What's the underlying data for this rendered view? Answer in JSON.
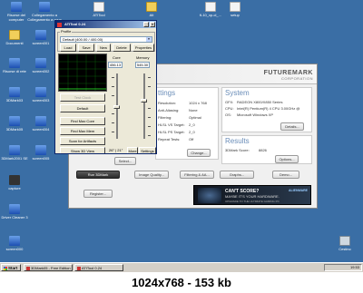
{
  "desktop": {
    "icons": [
      {
        "label": "Risorse del computer",
        "type": "blue"
      },
      {
        "label": "Collegamento a Collegamento a cpuz",
        "type": "blue"
      },
      {
        "label": "ATITool",
        "type": "doc"
      },
      {
        "label": "Alt",
        "type": "folder"
      },
      {
        "label": "fi-10_xp-cl_...",
        "type": "doc"
      },
      {
        "label": "setup",
        "type": "doc"
      },
      {
        "label": "Documenti",
        "type": "folder"
      },
      {
        "label": "screen001",
        "type": "blue"
      },
      {
        "label": "Risorse di rete",
        "type": "blue"
      },
      {
        "label": "screen002",
        "type": "blue"
      },
      {
        "label": "3DMark03",
        "type": "blue"
      },
      {
        "label": "screen003",
        "type": "blue"
      },
      {
        "label": "3DMark05",
        "type": "blue"
      },
      {
        "label": "screen004",
        "type": "blue"
      },
      {
        "label": "3DMark2001 SE",
        "type": "blue"
      },
      {
        "label": "screen005",
        "type": "blue"
      },
      {
        "label": "capture",
        "type": "dark"
      },
      {
        "label": "Driver Cleaner 3",
        "type": "blue"
      },
      {
        "label": "screen000",
        "type": "blue"
      },
      {
        "label": "Cestino",
        "type": "bin"
      }
    ]
  },
  "mark": {
    "brand": "FUTUREMARK",
    "brand_sub": "CORPORATION",
    "settings_title": "ttings",
    "settings_rows": [
      {
        "label": "Resolution:",
        "value": "1024 x 768"
      },
      {
        "label": "Anti-Aliasing:",
        "value": "None"
      },
      {
        "label": "Filtering:",
        "value": "Optimal"
      },
      {
        "label": "HLSL VS Target:",
        "value": "2_0"
      },
      {
        "label": "HLSL PS Target:",
        "value": "2_0"
      },
      {
        "label": "Repeat Tests:",
        "value": "Off"
      }
    ],
    "change_label": "Change...",
    "select_label": "Select...",
    "system_title": "System",
    "system_rows": [
      {
        "label": "GFX:",
        "value": "RADEON X800/X850 Series"
      },
      {
        "label": "CPU:",
        "value": "Intel(R) Pentium(R) 4 CPU 3.00GHz @"
      },
      {
        "label": "OS:",
        "value": "Microsoft Windows XP"
      }
    ],
    "details_label": "Details...",
    "results_title": "Results",
    "results_rows": [
      {
        "label": "3DMark Score:",
        "value": "8826"
      }
    ],
    "options_label": "Options...",
    "run_label": "Run 3DMark",
    "image_quality_label": "Image Quality...",
    "filtering_label": "Filtering & AA...",
    "graphs_label": "Graphs...",
    "demo_label": "Demo...",
    "register_label": "Register...",
    "ad": {
      "line1": "CAN'T SCORE?",
      "line2": "MAYBE IT'S YOUR HARDWARE.",
      "line3": "UPGRADE TO THE ULTIMATE GAMING PC",
      "brand": "ALIENWARE"
    }
  },
  "ati": {
    "title": "ATITool 0.24",
    "profile_label": "Profile",
    "profile_value": "Default (400.00 / 400.00)",
    "buttons": {
      "load": "Load",
      "save": "Save",
      "new": "New",
      "delete": "Delete",
      "properties": "Properties"
    },
    "temp_label": "Test Clock",
    "default_label": "Default",
    "find_core": "Find Max Core",
    "find_mem": "Find Max Mem",
    "scan": "Scan for Artifacts",
    "show3d": "Show 3D View",
    "core_label": "Core",
    "core_value": "456.13",
    "memory_label": "Memory",
    "memory_value": "545.30",
    "temp": "26° | 21°",
    "more": "More",
    "settings": "Settings"
  },
  "taskbar": {
    "start": "Start",
    "tasks": [
      "3DMark05 - Free Edition",
      "ATITool 0.24"
    ],
    "clock": "19.53"
  },
  "overlay": "1024x768 - 153 kb"
}
